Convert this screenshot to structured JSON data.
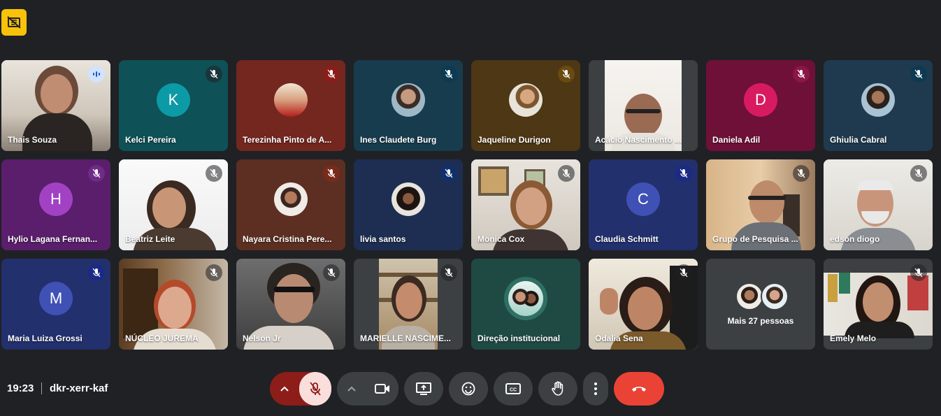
{
  "colors": {
    "page_bg": "#202124",
    "accent_warning": "#f9c20a",
    "end_call": "#ea4335",
    "mic_muted_bg": "#f9dedc",
    "mic_arrow_bg": "#8c1d18"
  },
  "top_badge": {
    "icon": "no-video-badge-icon"
  },
  "participants": [
    {
      "name": "Thais Souza",
      "mic": "speaking",
      "tile": "video"
    },
    {
      "name": "Kelci Pereira",
      "mic": "muted",
      "tile": "initial",
      "initial": "K"
    },
    {
      "name": "Terezinha Pinto de A...",
      "mic": "muted",
      "tile": "photo"
    },
    {
      "name": "Ines Claudete Burg",
      "mic": "muted",
      "tile": "photo"
    },
    {
      "name": "Jaqueline Durigon",
      "mic": "muted",
      "tile": "photo"
    },
    {
      "name": "Acácio Nascimento ...",
      "mic": "none",
      "tile": "video"
    },
    {
      "name": "Daniela Adil",
      "mic": "muted",
      "tile": "initial",
      "initial": "D"
    },
    {
      "name": "Ghiulia Cabral",
      "mic": "muted",
      "tile": "photo"
    },
    {
      "name": "Hylio Lagana Fernan...",
      "mic": "muted",
      "tile": "initial",
      "initial": "H"
    },
    {
      "name": "Beatriz Leite",
      "mic": "muted",
      "tile": "video"
    },
    {
      "name": "Nayara Cristina Pere...",
      "mic": "muted",
      "tile": "photo"
    },
    {
      "name": "livia santos",
      "mic": "muted",
      "tile": "photo"
    },
    {
      "name": "Monica Cox",
      "mic": "muted",
      "tile": "video"
    },
    {
      "name": "Claudia Schmitt",
      "mic": "muted",
      "tile": "initial",
      "initial": "C"
    },
    {
      "name": "Grupo de Pesquisa ...",
      "mic": "muted",
      "tile": "video"
    },
    {
      "name": "edson diogo",
      "mic": "muted",
      "tile": "video"
    },
    {
      "name": "Maria Luiza Grossi",
      "mic": "muted",
      "tile": "initial",
      "initial": "M"
    },
    {
      "name": "NÚCLEO JUREMA",
      "mic": "muted",
      "tile": "video"
    },
    {
      "name": "Nelson Jr",
      "mic": "muted",
      "tile": "video"
    },
    {
      "name": "MARIELLE NASCIME...",
      "mic": "muted",
      "tile": "video"
    },
    {
      "name": "Direção institucional",
      "mic": "none",
      "tile": "photo"
    },
    {
      "name": "Odalia Sena",
      "mic": "muted",
      "tile": "video"
    },
    {
      "name": "Mais 27 pessoas",
      "mic": "none",
      "tile": "more"
    },
    {
      "name": "Emely Melo",
      "mic": "muted",
      "tile": "video"
    }
  ],
  "meeting": {
    "time": "19:23",
    "code": "dkr-xerr-kaf"
  },
  "controls": {
    "mic": {
      "state": "muted",
      "icon": "mic-off-icon",
      "options_icon": "chevron-up-icon"
    },
    "camera": {
      "icon": "videocam-icon",
      "options_icon": "chevron-up-icon"
    },
    "present": {
      "icon": "present-screen-icon"
    },
    "emoji": {
      "icon": "emoji-icon"
    },
    "captions": {
      "icon": "closed-captions-icon"
    },
    "raise_hand": {
      "icon": "raise-hand-icon"
    },
    "more": {
      "icon": "more-vert-icon"
    },
    "leave": {
      "icon": "call-end-icon"
    }
  }
}
